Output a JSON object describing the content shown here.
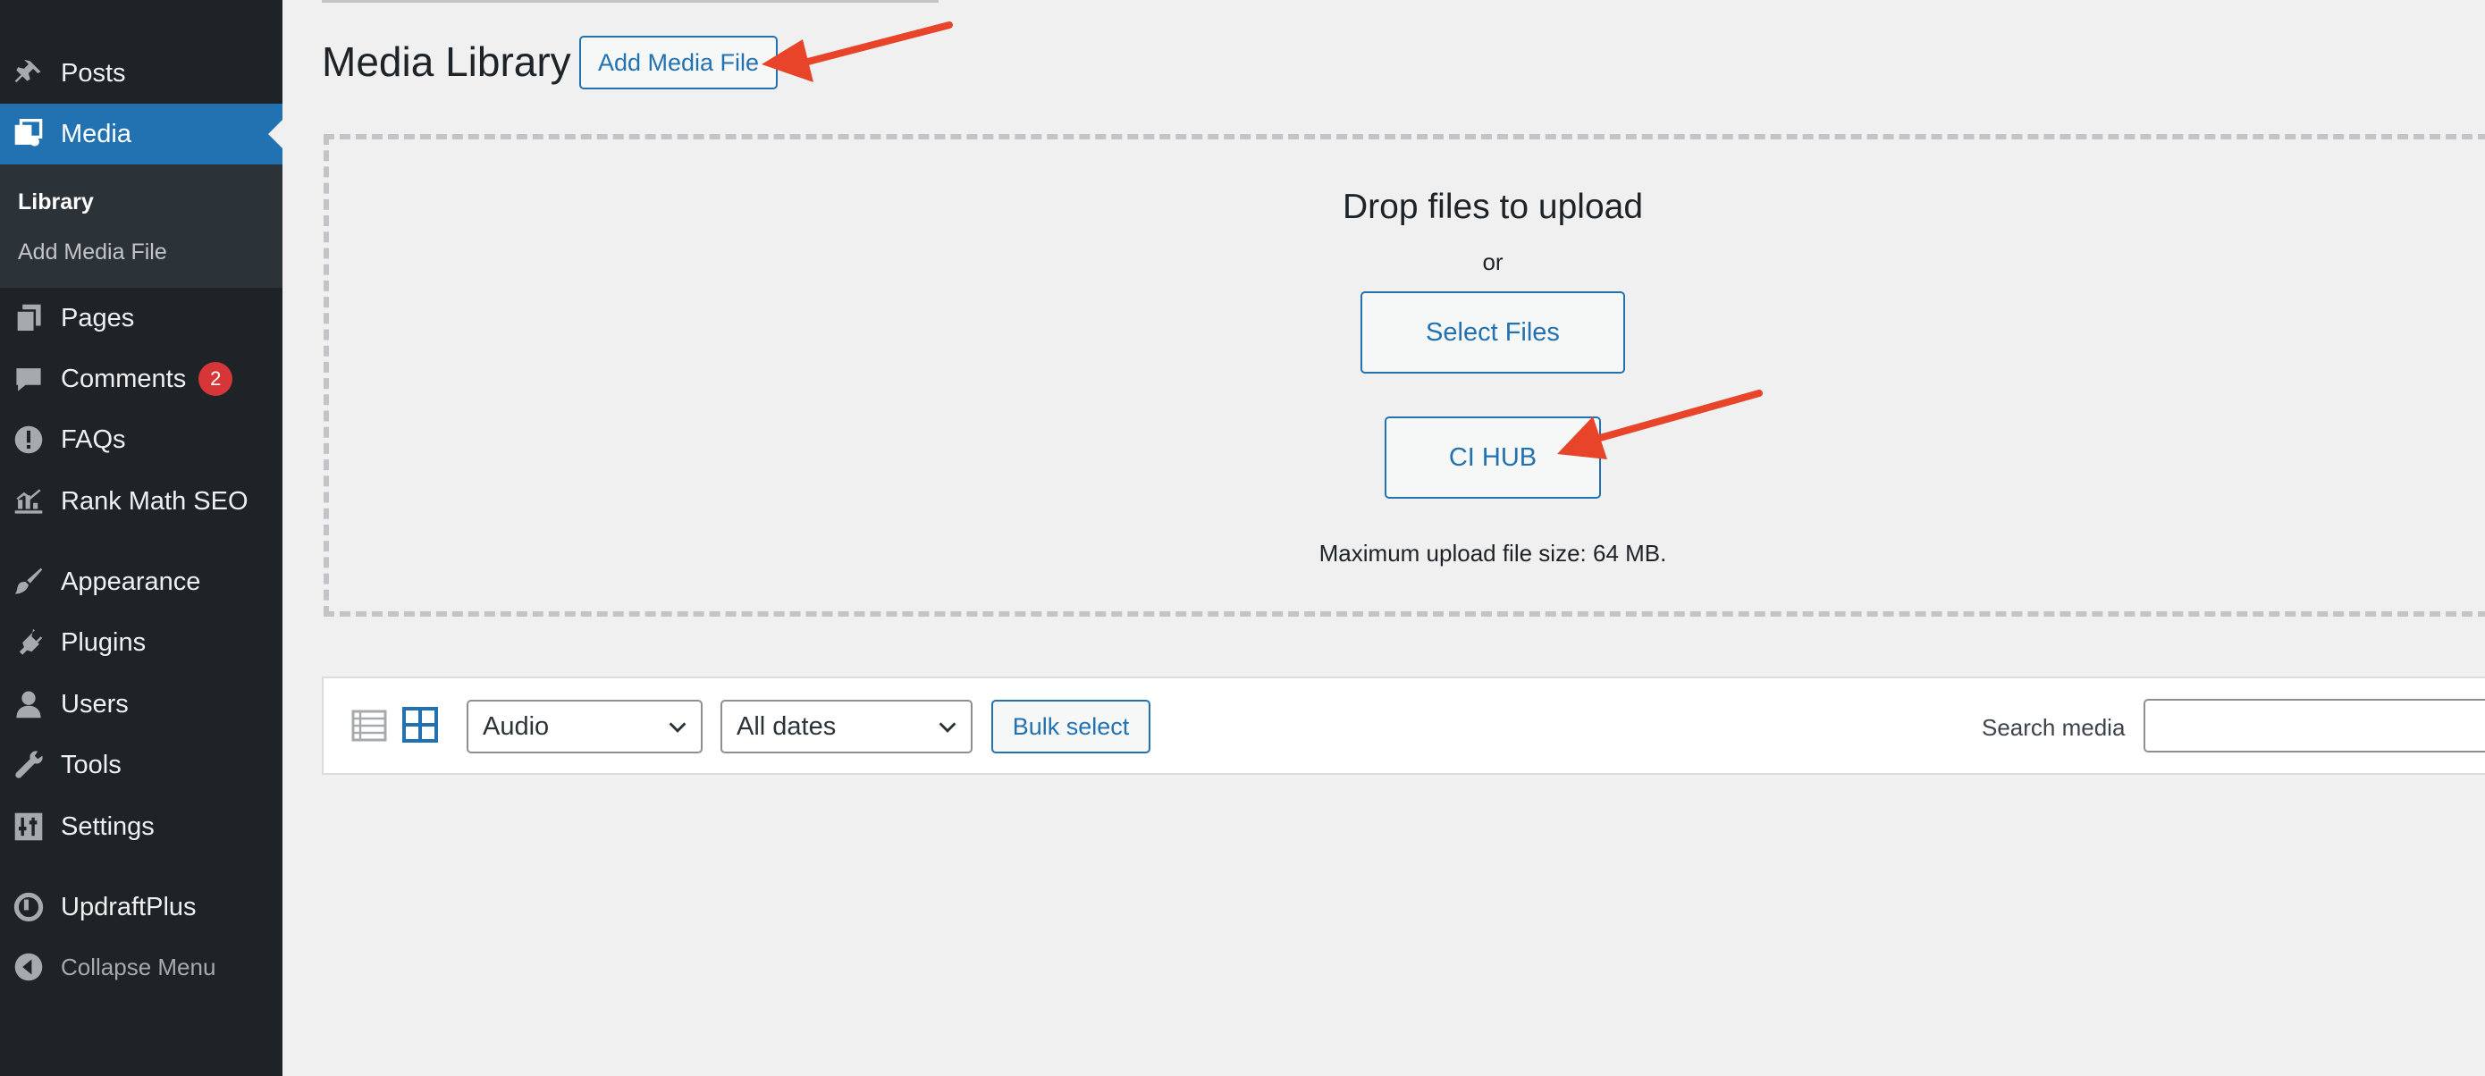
{
  "sidebar": {
    "items": [
      {
        "name": "posts",
        "label": "Posts",
        "icon": "pin-icon"
      },
      {
        "name": "media",
        "label": "Media",
        "icon": "media-icon",
        "current": true
      },
      {
        "name": "pages",
        "label": "Pages",
        "icon": "pages-icon"
      },
      {
        "name": "comments",
        "label": "Comments",
        "icon": "comment-icon",
        "badge": "2"
      },
      {
        "name": "faqs",
        "label": "FAQs",
        "icon": "exclamation-icon"
      },
      {
        "name": "rank-math-seo",
        "label": "Rank Math SEO",
        "icon": "chart-icon"
      },
      {
        "name": "appearance",
        "label": "Appearance",
        "icon": "brush-icon"
      },
      {
        "name": "plugins",
        "label": "Plugins",
        "icon": "plug-icon"
      },
      {
        "name": "users",
        "label": "Users",
        "icon": "user-icon"
      },
      {
        "name": "tools",
        "label": "Tools",
        "icon": "wrench-icon"
      },
      {
        "name": "settings",
        "label": "Settings",
        "icon": "sliders-icon"
      },
      {
        "name": "updraftplus",
        "label": "UpdraftPlus",
        "icon": "updraft-icon"
      }
    ],
    "submenu": [
      {
        "label": "Library",
        "active": true
      },
      {
        "label": "Add Media File"
      }
    ],
    "collapse_label": "Collapse Menu"
  },
  "header": {
    "title": "Media Library",
    "add_button": "Add Media File"
  },
  "uploader": {
    "drop_text": "Drop files to upload",
    "or_text": "or",
    "select_button": "Select Files",
    "ci_hub_button": "CI HUB",
    "max_size": "Maximum upload file size: 64 MB."
  },
  "toolbar": {
    "type_filter": "Audio",
    "date_filter": "All dates",
    "bulk_select": "Bulk select",
    "search_label": "Search media",
    "search_value": ""
  },
  "colors": {
    "sidebar_bg": "#1d2327",
    "accent": "#2271b1",
    "annotation_arrow": "#e8442a",
    "badge": "#d63638"
  }
}
